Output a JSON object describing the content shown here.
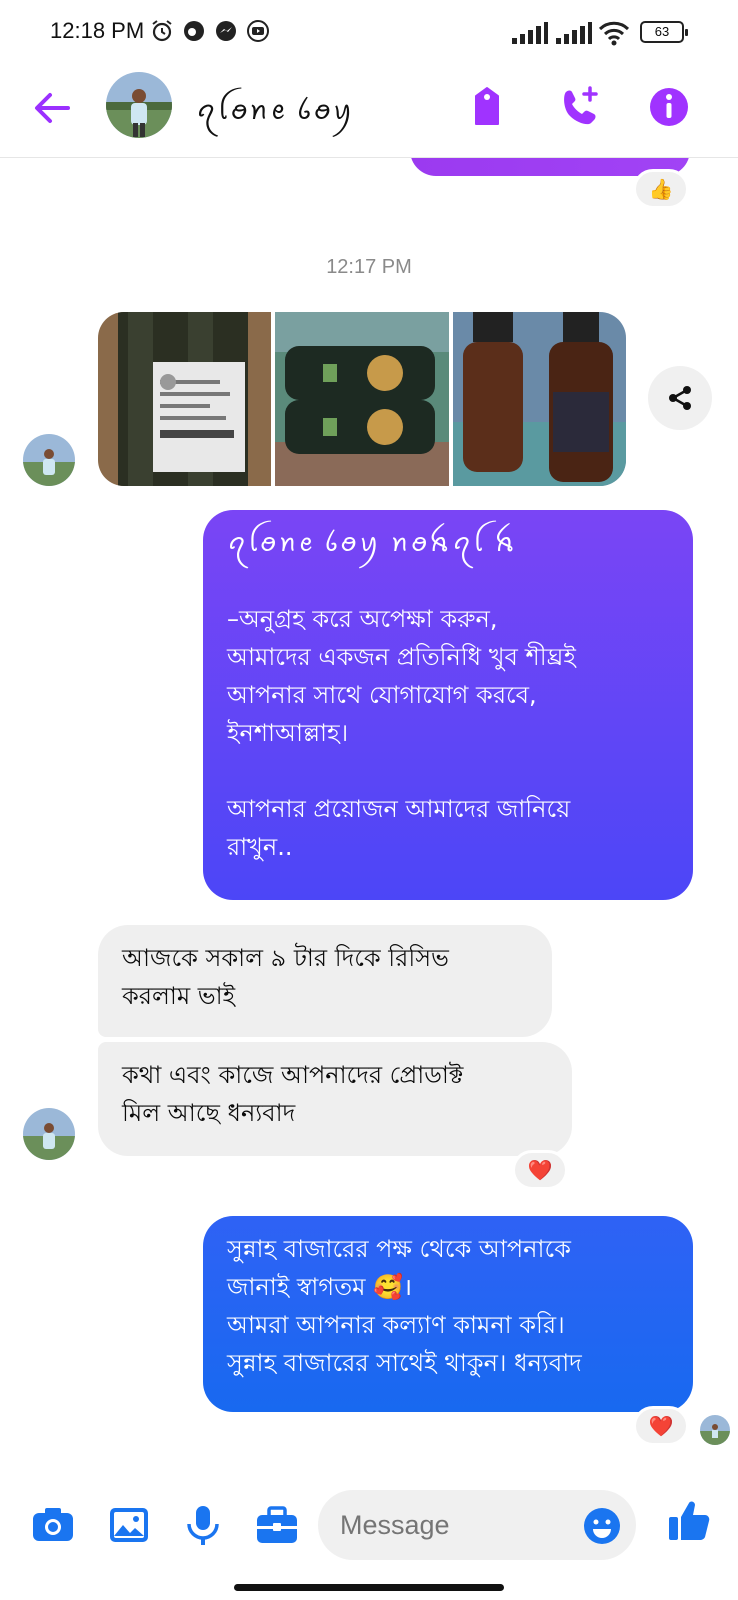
{
  "status_bar": {
    "time": "12:18 PM",
    "battery": "63"
  },
  "header": {
    "contact_name": "ꪖꪶꪮꪀꫀ ꪉꪮꪗ"
  },
  "conversation": {
    "timestamp": "12:17 PM",
    "message_1": {
      "title": "ꪖꪶꪮꪀꫀ ꪉꪮꪗ ꪀꪮꫝꪖꪶ ꫝ",
      "lines": [
        "–অনুগ্রহ করে অপেক্ষা করুন,",
        "আমাদের একজন প্রতিনিধি খুব শীঘ্রই",
        "আপনার সাথে যোগাযোগ করবে,",
        "ইনশাআল্লাহ।",
        "",
        "আপনার প্রয়োজন আমাদের জানিয়ে",
        "রাখুন.."
      ]
    },
    "message_2": {
      "lines": [
        "আজকে সকাল ৯ টার দিকে রিসিভ",
        "করলাম ভাই"
      ]
    },
    "message_3": {
      "lines": [
        "কথা এবং কাজে আপনাদের প্রোডাক্ট",
        "মিল আছে ধন্যবাদ"
      ]
    },
    "message_4": {
      "lines": [
        "সুন্নাহ বাজারের পক্ষ থেকে আপনাকে",
        "জানাই স্বাগতম 🥰।",
        "আমরা আপনার কল্যাণ কামনা করি।",
        "সুন্নাহ বাজারের সাথেই থাকুন। ধন্যবাদ"
      ]
    },
    "reactions": {
      "thumbs": "👍",
      "heart": "❤️"
    }
  },
  "composer": {
    "placeholder": "Message"
  },
  "colors": {
    "accent": "#a033ff",
    "outgoing_blue": "#1a68f0",
    "outgoing_purple": "#6a46f6",
    "incoming_bg": "#efefef"
  }
}
